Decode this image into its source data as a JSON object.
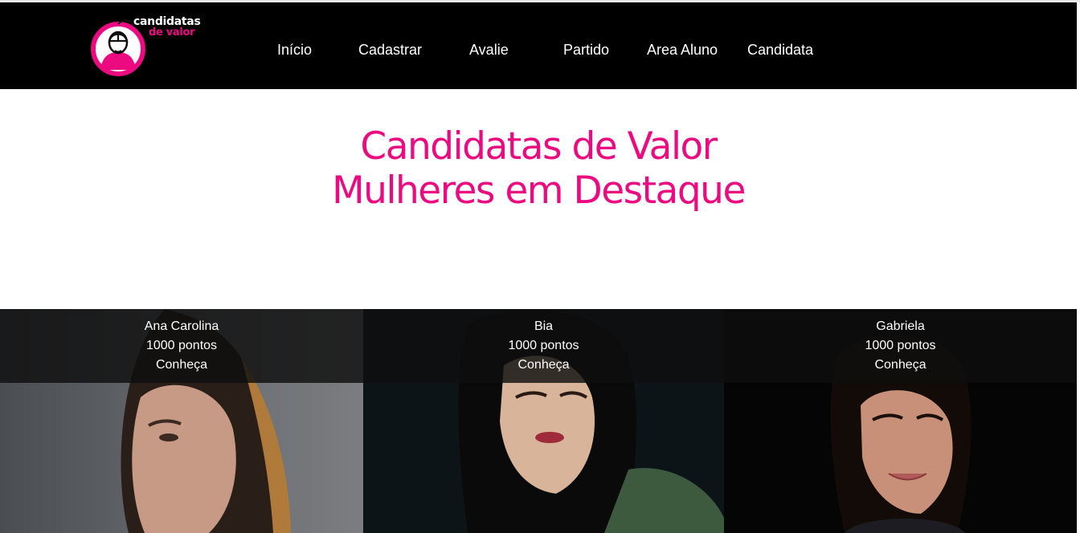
{
  "header": {
    "logo": {
      "line1": "candidatas",
      "line2": "de valor",
      "icon": "woman-with-mouse-icon"
    },
    "nav": [
      {
        "label": "Início"
      },
      {
        "label": "Cadastrar"
      },
      {
        "label": "Avalie"
      },
      {
        "label": "Partido"
      },
      {
        "label": "Area Aluno"
      },
      {
        "label": "Candidata"
      }
    ]
  },
  "hero": {
    "title_line1": "Candidatas de Valor",
    "title_line2": "Mulheres em Destaque"
  },
  "candidates": [
    {
      "name": "Ana Carolina",
      "points": "1000 pontos",
      "link": "Conheça"
    },
    {
      "name": "Bia",
      "points": "1000 pontos",
      "link": "Conheça"
    },
    {
      "name": "Gabriela",
      "points": "1000 pontos",
      "link": "Conheça"
    }
  ],
  "colors": {
    "accent": "#ec0a80",
    "navbar": "#000000",
    "text_on_dark": "#ffffff"
  }
}
